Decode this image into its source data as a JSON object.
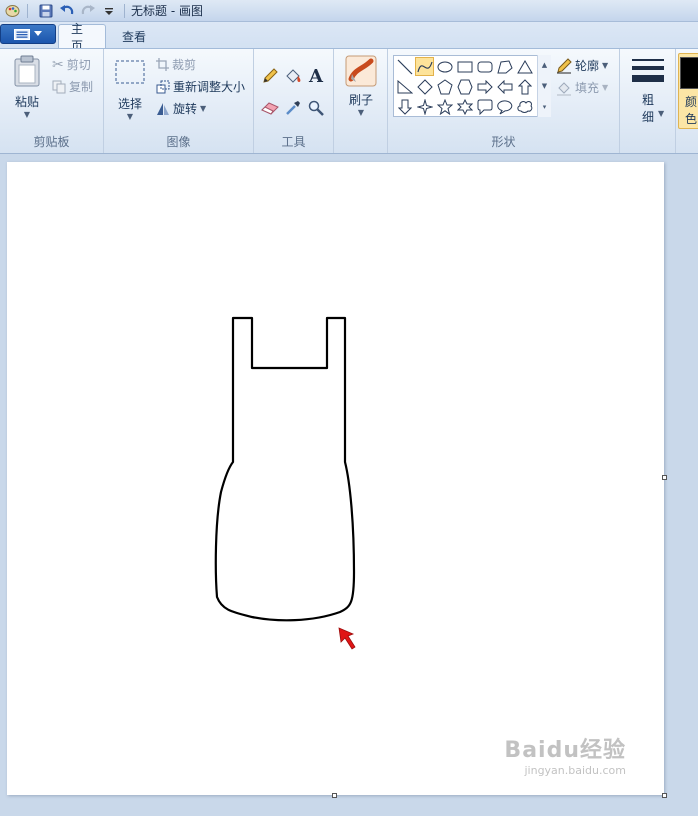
{
  "window": {
    "title": "无标题 - 画图"
  },
  "tabs": [
    {
      "label": "主页",
      "active": true
    },
    {
      "label": "查看",
      "active": false
    }
  ],
  "clipboard": {
    "paste_label": "粘贴",
    "cut_label": "剪切",
    "copy_label": "复制",
    "group_label": "剪贴板"
  },
  "image": {
    "select_label": "选择",
    "crop_label": "裁剪",
    "resize_label": "重新调整大小",
    "rotate_label": "旋转",
    "group_label": "图像"
  },
  "tools": {
    "items": [
      "pencil-icon",
      "fill-bucket-icon",
      "text-icon",
      "eraser-icon",
      "color-picker-icon",
      "magnifier-icon"
    ],
    "text_glyph": "A",
    "group_label": "工具"
  },
  "brushes": {
    "label": "刷子"
  },
  "shapes": {
    "items": [
      "line",
      "curve",
      "oval",
      "rectangle",
      "rounded-rectangle",
      "polygon",
      "triangle",
      "right-triangle",
      "diamond",
      "pentagon",
      "hexagon",
      "right-arrow",
      "left-arrow",
      "up-arrow",
      "down-arrow",
      "four-point-star",
      "five-point-star",
      "six-point-star",
      "rounded-callout",
      "oval-callout",
      "cloud-callout"
    ],
    "selected": "curve",
    "outline_label": "轮廓",
    "fill_label": "填充",
    "group_label": "形状"
  },
  "size": {
    "label_line1": "粗",
    "label_line2": "细"
  },
  "colors": {
    "color1_label_line1": "颜",
    "color1_label_line2": "色",
    "color1": "#000000"
  },
  "watermark": {
    "logo": "Baidu经验",
    "url": "jingyan.baidu.com"
  },
  "accent": {
    "cursor_arrow": "#e01515",
    "selected_shape": "#fde39a"
  }
}
